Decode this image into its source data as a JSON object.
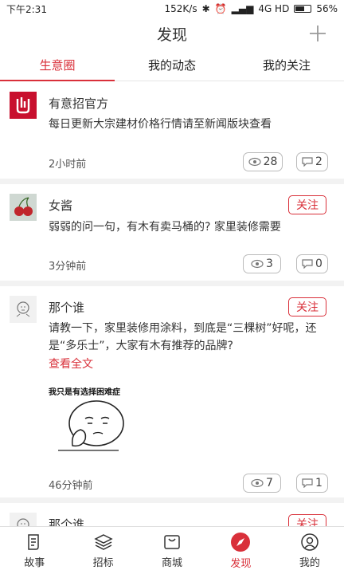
{
  "status_bar": {
    "time": "下午2:31",
    "speed": "152K/s",
    "signal": "4G HD",
    "battery": "56%"
  },
  "header": {
    "title": "发现"
  },
  "tabs": [
    {
      "label": "生意圈",
      "active": true
    },
    {
      "label": "我的动态",
      "active": false
    },
    {
      "label": "我的关注",
      "active": false
    }
  ],
  "posts": [
    {
      "name": "有意招官方",
      "content": "每日更新大宗建材价格行情请至新闻版块查看",
      "time": "2小时前",
      "views": "28",
      "comments": "2"
    },
    {
      "name": "女酱",
      "follow": "关注",
      "content": "弱弱的问一句，有木有卖马桶的? 家里装修需要",
      "time": "3分钟前",
      "views": "3",
      "comments": "0"
    },
    {
      "name": "那个谁",
      "follow": "关注",
      "content_line1": "请教一下，家里装修用涂料，到底是“三棵树”好呢，还",
      "content_line2": "是“多乐士”，大家有木有推荐的品牌?",
      "more": "查看全文",
      "image_caption": "我只是有选择困难症",
      "time": "46分钟前",
      "views": "7",
      "comments": "1"
    },
    {
      "name": "那个谁",
      "follow": "关注"
    }
  ],
  "bottom_nav": [
    {
      "label": "故事",
      "icon": "story-icon",
      "active": false
    },
    {
      "label": "招标",
      "icon": "layers-icon",
      "active": false
    },
    {
      "label": "商城",
      "icon": "shop-icon",
      "active": false
    },
    {
      "label": "发现",
      "icon": "compass-icon",
      "active": true
    },
    {
      "label": "我的",
      "icon": "user-icon",
      "active": false
    }
  ],
  "colors": {
    "accent": "#d9303a",
    "brand_logo": "#c8102e"
  }
}
